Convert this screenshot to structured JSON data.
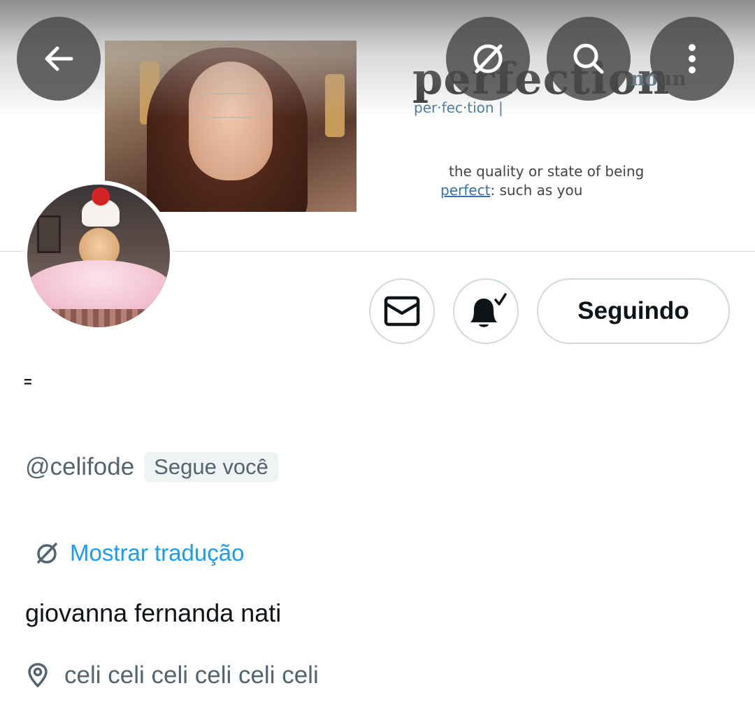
{
  "header": {
    "banner_definition": {
      "word": "perfection",
      "part_of_speech": "noun",
      "phonetic": "per·fec·tion |",
      "line1": "the quality or state of being",
      "line2_highlight": "perfect",
      "line2_rest": ": such as you"
    },
    "icons": {
      "back": "arrow-left-icon",
      "translate": "translate-icon",
      "search": "search-icon",
      "more": "more-vertical-icon"
    }
  },
  "actions": {
    "message_icon": "mail-icon",
    "notifications_icon": "bell-check-icon",
    "follow_label": "Seguindo"
  },
  "profile": {
    "display_name": "=",
    "handle": "@celifode",
    "follows_you": "Segue você",
    "show_translation": "Mostrar tradução",
    "bio": "giovanna fernanda nati",
    "location": "celi celi celi celi celi celi"
  },
  "colors": {
    "link": "#1d9bf0",
    "secondary_text": "#536471",
    "border": "#cfd9de"
  }
}
